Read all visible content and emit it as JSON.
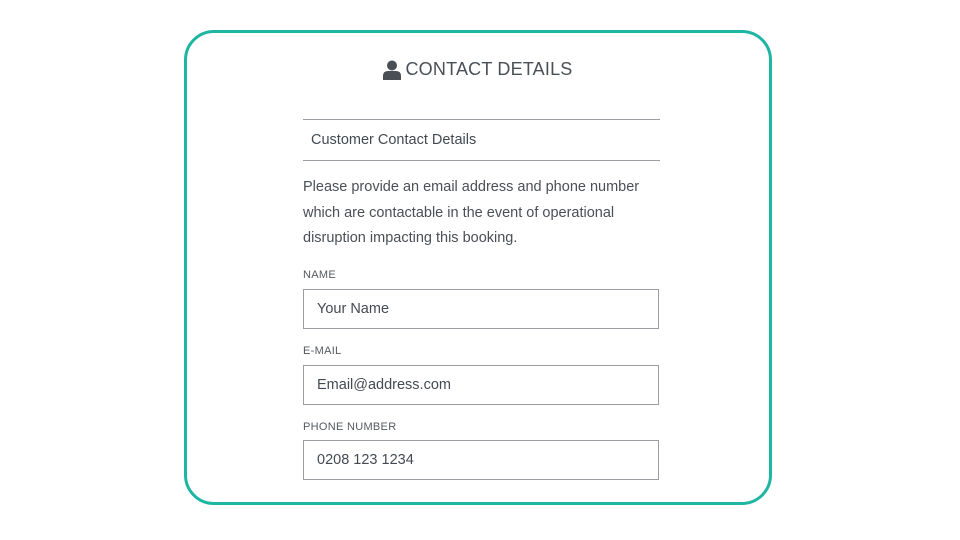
{
  "form": {
    "title": "CONTACT DETAILS",
    "title_icon": "user-icon",
    "section_header": "Customer Contact Details",
    "instructions": "Please provide an email address and phone number which are contactable in the event of operational disruption impacting this booking.",
    "fields": [
      {
        "label": "NAME",
        "value": "Your Name"
      },
      {
        "label": "E-MAIL",
        "value": "Email@address.com"
      },
      {
        "label": "PHONE NUMBER",
        "value": "0208 123 1234"
      }
    ]
  },
  "colors": {
    "card_border": "#1fb5a3",
    "text": "#444a52",
    "field_border": "#9a9ea3"
  }
}
